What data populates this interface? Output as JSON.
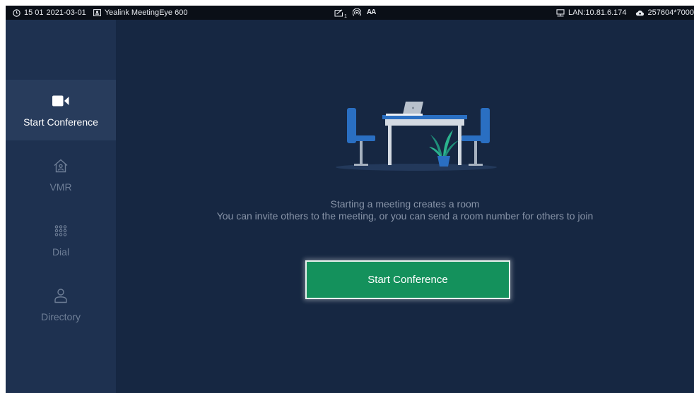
{
  "status_bar": {
    "time": "15 01",
    "date": "2021-03-01",
    "device": "Yealink MeetingEye 600",
    "center_badge": "1",
    "center_text_icon": "AA",
    "lan": "LAN:10.81.6.174",
    "account": "257604*7000"
  },
  "sidebar": {
    "items": [
      {
        "label": "Start Conference",
        "icon": "video-camera-icon",
        "active": true
      },
      {
        "label": "VMR",
        "icon": "home-user-icon",
        "active": false
      },
      {
        "label": "Dial",
        "icon": "dialpad-icon",
        "active": false
      },
      {
        "label": "Directory",
        "icon": "person-icon",
        "active": false
      }
    ]
  },
  "main": {
    "message_line1": "Starting a meeting creates a room",
    "message_line2": "You can invite others to the meeting, or you can send a room number for others to join",
    "button_label": "Start Conference"
  },
  "colors": {
    "background": "#162742",
    "sidebar": "#1e3150",
    "sidebar_active": "#283c5c",
    "button": "#14915c",
    "status_bar": "#0a0f17"
  }
}
